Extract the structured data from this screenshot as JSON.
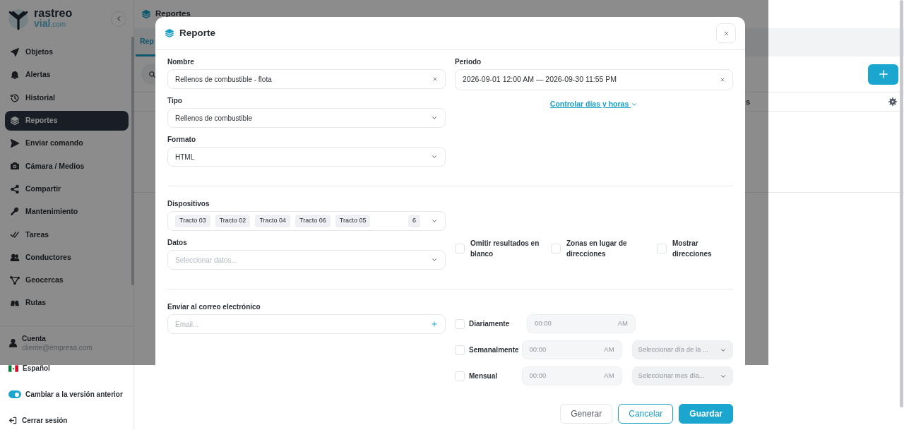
{
  "sidebar": {
    "logo": {
      "word1": "rastreo",
      "word2": "vial",
      "domain": ".com"
    },
    "items": [
      {
        "label": "Objetos",
        "selected": false
      },
      {
        "label": "Alertas",
        "selected": false
      },
      {
        "label": "Historial",
        "selected": false
      },
      {
        "label": "Reportes",
        "selected": true
      },
      {
        "label": "Enviar comando",
        "selected": false
      },
      {
        "label": "Cámara / Medios",
        "selected": false
      },
      {
        "label": "Compartir",
        "selected": false
      },
      {
        "label": "Mantenimiento",
        "selected": false
      },
      {
        "label": "Tareas",
        "selected": false
      },
      {
        "label": "Conductores",
        "selected": false
      },
      {
        "label": "Geocercas",
        "selected": false
      },
      {
        "label": "Rutas",
        "selected": false
      }
    ],
    "account": {
      "label": "Cuenta",
      "email": "cliente@empresa.com"
    },
    "language": "Español",
    "legacy_toggle": {
      "label": "Cambiar a la versión anterior",
      "on": true
    },
    "logout": "Cerrar sesión"
  },
  "page": {
    "title": "Reportes",
    "tabs": [
      {
        "label": "Rep",
        "selected": true
      }
    ],
    "column_2": "s"
  },
  "modal": {
    "title": "Reporte",
    "name_field": {
      "label": "Nombre",
      "value": "Rellenos de combustible - flota"
    },
    "period_field": {
      "label": "Periodo",
      "value": "2026-09-01 12:00 AM — 2026-09-30 11:55 PM"
    },
    "days_hours_link": {
      "label": "Controlar días y horas",
      "expanded": false
    },
    "type_field": {
      "label": "Tipo",
      "value": "Rellenos de combustible"
    },
    "format_field": {
      "label": "Formato",
      "value": "HTML"
    },
    "devices_field": {
      "label": "Dispositivos",
      "tags": [
        "Tracto 03",
        "Tracto 02",
        "Tracto 04",
        "Tracto 06",
        "Tracto 05"
      ],
      "count": "6"
    },
    "data_field": {
      "label": "Datos",
      "placeholder": "Seleccionar datos..."
    },
    "options": [
      {
        "label": "Omitir resultados en blanco",
        "checked": false
      },
      {
        "label": "Zonas en lugar de direcciones",
        "checked": false
      },
      {
        "label": "Mostrar direcciones",
        "checked": false
      }
    ],
    "email_field": {
      "label": "Enviar al correo electrónico",
      "placeholder": "Email..."
    },
    "schedules": [
      {
        "label": "Diariamente",
        "checked": false,
        "time_placeholder": "00:00",
        "meridiem": "AM"
      },
      {
        "label": "Semanalmente",
        "checked": false,
        "time_placeholder": "00:00",
        "meridiem": "AM",
        "select_placeholder": "Seleccionar día de la ..."
      },
      {
        "label": "Mensual",
        "checked": false,
        "time_placeholder": "00:00",
        "meridiem": "AM",
        "select_placeholder": "Seleccionar mes día..."
      }
    ],
    "buttons": [
      {
        "label": "Generar",
        "kind": "secondary"
      },
      {
        "label": "Cancelar",
        "kind": "outline"
      },
      {
        "label": "Guardar",
        "kind": "primary"
      }
    ]
  }
}
